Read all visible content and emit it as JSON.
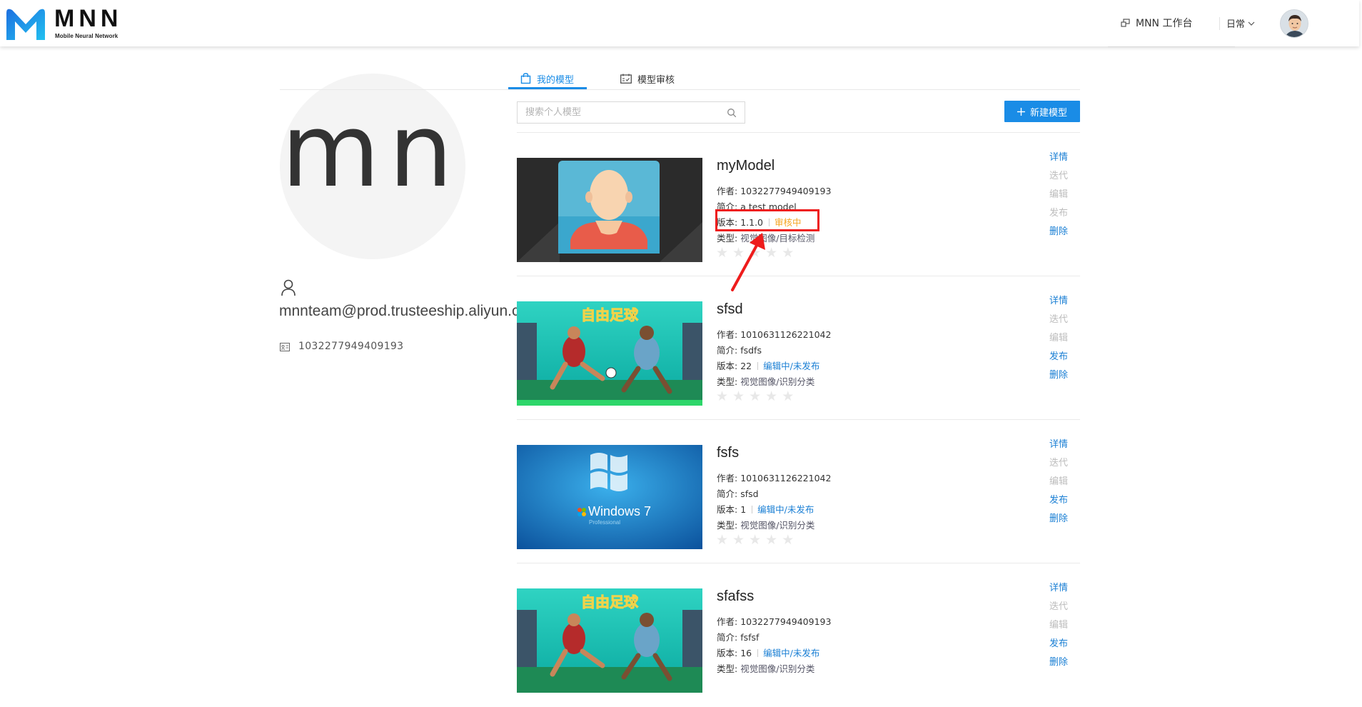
{
  "header": {
    "logo_text": "MNN",
    "logo_subtitle": "Mobile Neural Network",
    "workbench_label": "MNN 工作台",
    "env_label": "日常"
  },
  "profile": {
    "avatar_initials": "mn",
    "email": "mnnteam@prod.trusteeship.aliyun.com",
    "user_id": "1032277949409193"
  },
  "tabs": [
    {
      "label": "我的模型",
      "active": true
    },
    {
      "label": "模型审核",
      "active": false
    }
  ],
  "search": {
    "placeholder": "搜索个人模型"
  },
  "new_button_label": "新建模型",
  "labels": {
    "author": "作者:",
    "intro": "简介:",
    "version": "版本:",
    "type": "类型:"
  },
  "actions": [
    "详情",
    "迭代",
    "编辑",
    "发布",
    "删除"
  ],
  "models": [
    {
      "name": "myModel",
      "author": "1032277949409193",
      "intro": "a test model",
      "version": "1.1.0",
      "status": "审核中",
      "type": "视觉图像/目标检测",
      "rating": 0,
      "thumb": "default-avatar",
      "enabled_actions": [
        "详情",
        "删除"
      ]
    },
    {
      "name": "sfsd",
      "author": "1010631126221042",
      "intro": "fsdfs",
      "version": "22",
      "status": "编辑中/未发布",
      "type": "视觉图像/识别分类",
      "rating": 0,
      "thumb": "soccer-game",
      "enabled_actions": [
        "详情",
        "发布",
        "删除"
      ]
    },
    {
      "name": "fsfs",
      "author": "1010631126221042",
      "intro": "sfsd",
      "version": "1",
      "status": "编辑中/未发布",
      "type": "视觉图像/识别分类",
      "rating": 0,
      "thumb": "windows-7",
      "thumb_text": "Windows 7",
      "thumb_subtext": "Professional",
      "enabled_actions": [
        "详情",
        "发布",
        "删除"
      ]
    },
    {
      "name": "sfafss",
      "author": "1032277949409193",
      "intro": "fsfsf",
      "version": "16",
      "status": "编辑中/未发布",
      "type": "视觉图像/识别分类",
      "rating": 0,
      "thumb": "soccer-game",
      "enabled_actions": [
        "详情",
        "发布",
        "删除"
      ]
    }
  ],
  "colors": {
    "accent": "#1a8ce6",
    "status_review": "#f5a623",
    "annotation_red": "#ee1c1c"
  }
}
